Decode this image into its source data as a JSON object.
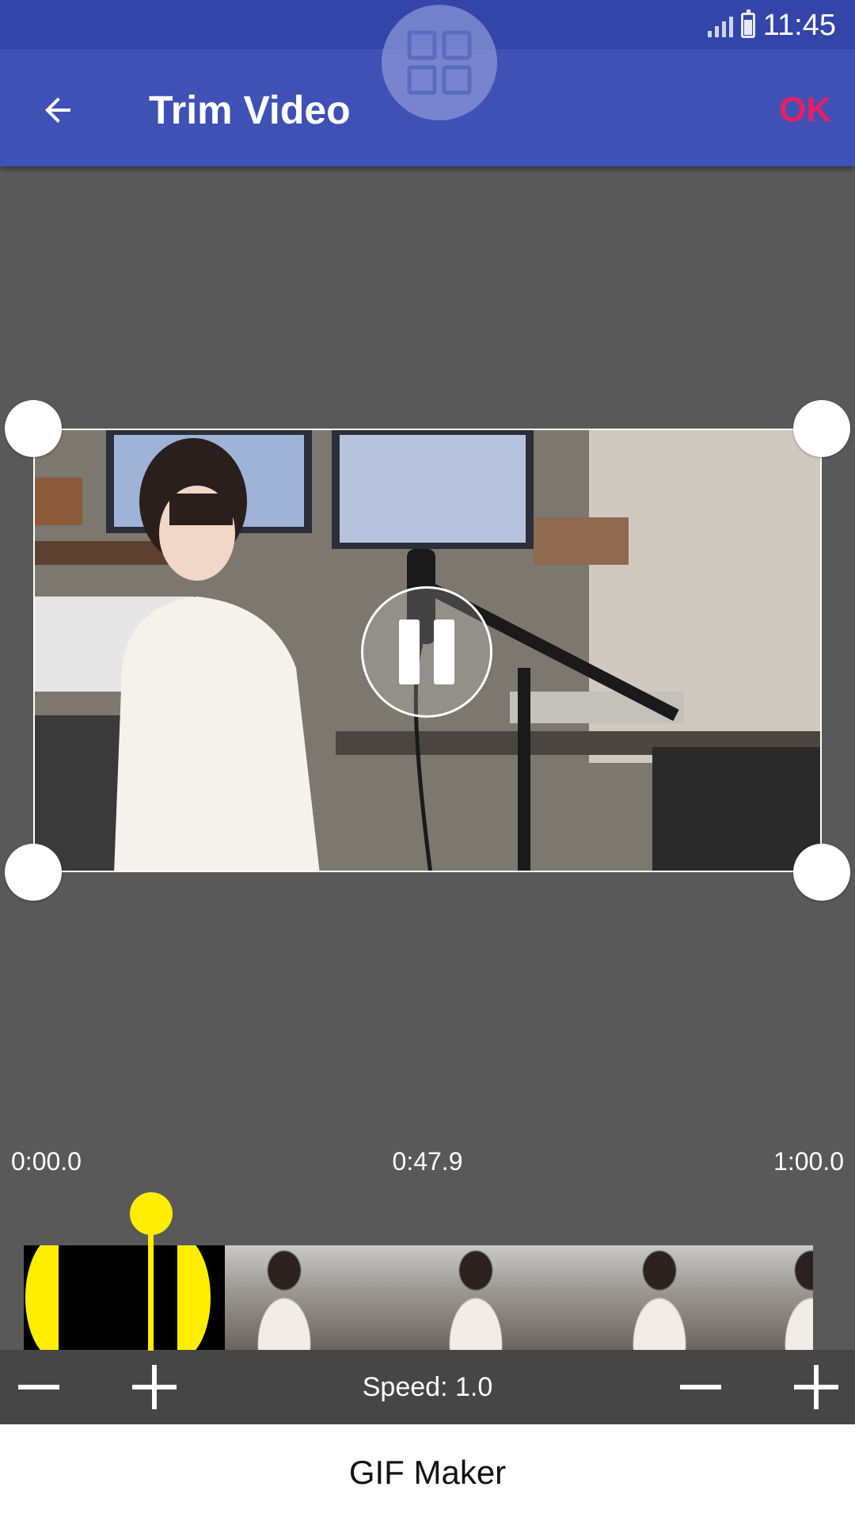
{
  "status_bar": {
    "time": "11:45",
    "icons": [
      "signal-icon",
      "battery-icon"
    ]
  },
  "app_bar": {
    "title": "Trim Video",
    "back_icon": "arrow-back-icon",
    "ok_label": "OK",
    "floating_icon": "grid-icon"
  },
  "colors": {
    "app_bar": "#3f51b5",
    "status_bar": "#3345a8",
    "ok": "#e91e63",
    "trim_handle": "#ffee00",
    "background": "#595959"
  },
  "player": {
    "state_icon": "pause-icon"
  },
  "timeline": {
    "start": "0:00.0",
    "current": "0:47.9",
    "end": "1:00.0"
  },
  "speed": {
    "label": "Speed: 1.0",
    "left_decrease_icon": "minus-icon",
    "left_increase_icon": "plus-icon",
    "right_decrease_icon": "minus-icon",
    "right_increase_icon": "plus-icon"
  },
  "footer": {
    "label": "GIF Maker"
  }
}
